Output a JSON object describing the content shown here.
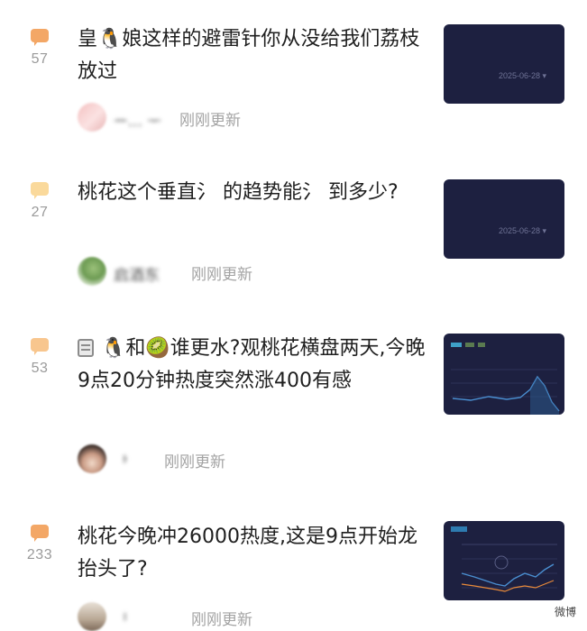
{
  "colors": {
    "bubble_light": "#f8c68e",
    "bubble_strong": "#f3a766",
    "bubble_yellow": "#fad99b",
    "thumb_bg": "#1d2040"
  },
  "posts": [
    {
      "count": "57",
      "title": "皇🐧娘这样的避雷针你从没给我们荔枝放过",
      "author": "ᅭ... ᅮ",
      "time": "刚刚更新",
      "thumb_date": "2025-06-28 ▾"
    },
    {
      "count": "27",
      "title": "桃花这个垂直氵 的趋势能氵 到多少?",
      "author": "启酒东",
      "time": "刚刚更新",
      "thumb_date": "2025-06-28 ▾"
    },
    {
      "count": "53",
      "title_prefix_icon": "document-icon",
      "title": "🐧和🥝谁更水?观桃花横盘两天,今晚9点20分钟热度突然涨400有感",
      "author": "ᅡ",
      "time": "刚刚更新",
      "thumb_date": ""
    },
    {
      "count": "233",
      "title": "桃花今晚冲26000热度,这是9点开始龙抬头了?",
      "author": "ᅵ",
      "time": "刚刚更新",
      "thumb_date": ""
    }
  ],
  "watermark": "微博"
}
